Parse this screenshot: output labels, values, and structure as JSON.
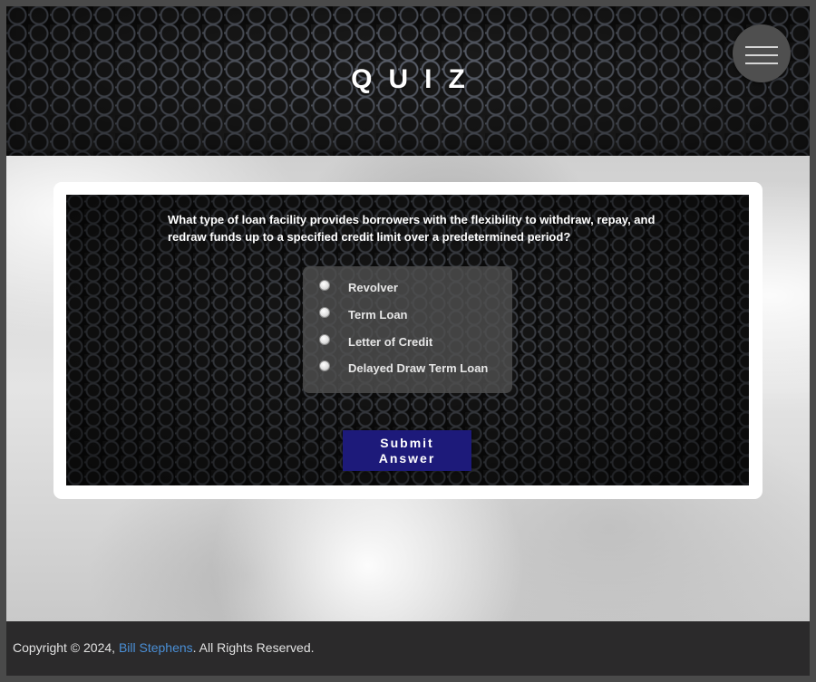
{
  "header": {
    "title": "QUIZ",
    "menu_icon": "hamburger-menu-icon"
  },
  "quiz": {
    "question": "What type of loan facility provides borrowers with the flexibility to withdraw, repay, and redraw funds up to a specified credit limit over a predetermined period?",
    "options": [
      {
        "label": "Revolver",
        "selected": false
      },
      {
        "label": "Term Loan",
        "selected": false
      },
      {
        "label": "Letter of Credit",
        "selected": false
      },
      {
        "label": "Delayed Draw Term Loan",
        "selected": false
      }
    ],
    "submit_label": "Submit Answer",
    "submit_color": "#1d1a7a"
  },
  "footer": {
    "prefix": "Copyright © 2024, ",
    "author_link": "Bill Stephens",
    "suffix": ". All Rights Reserved.",
    "link_color": "#4a8fd6"
  }
}
